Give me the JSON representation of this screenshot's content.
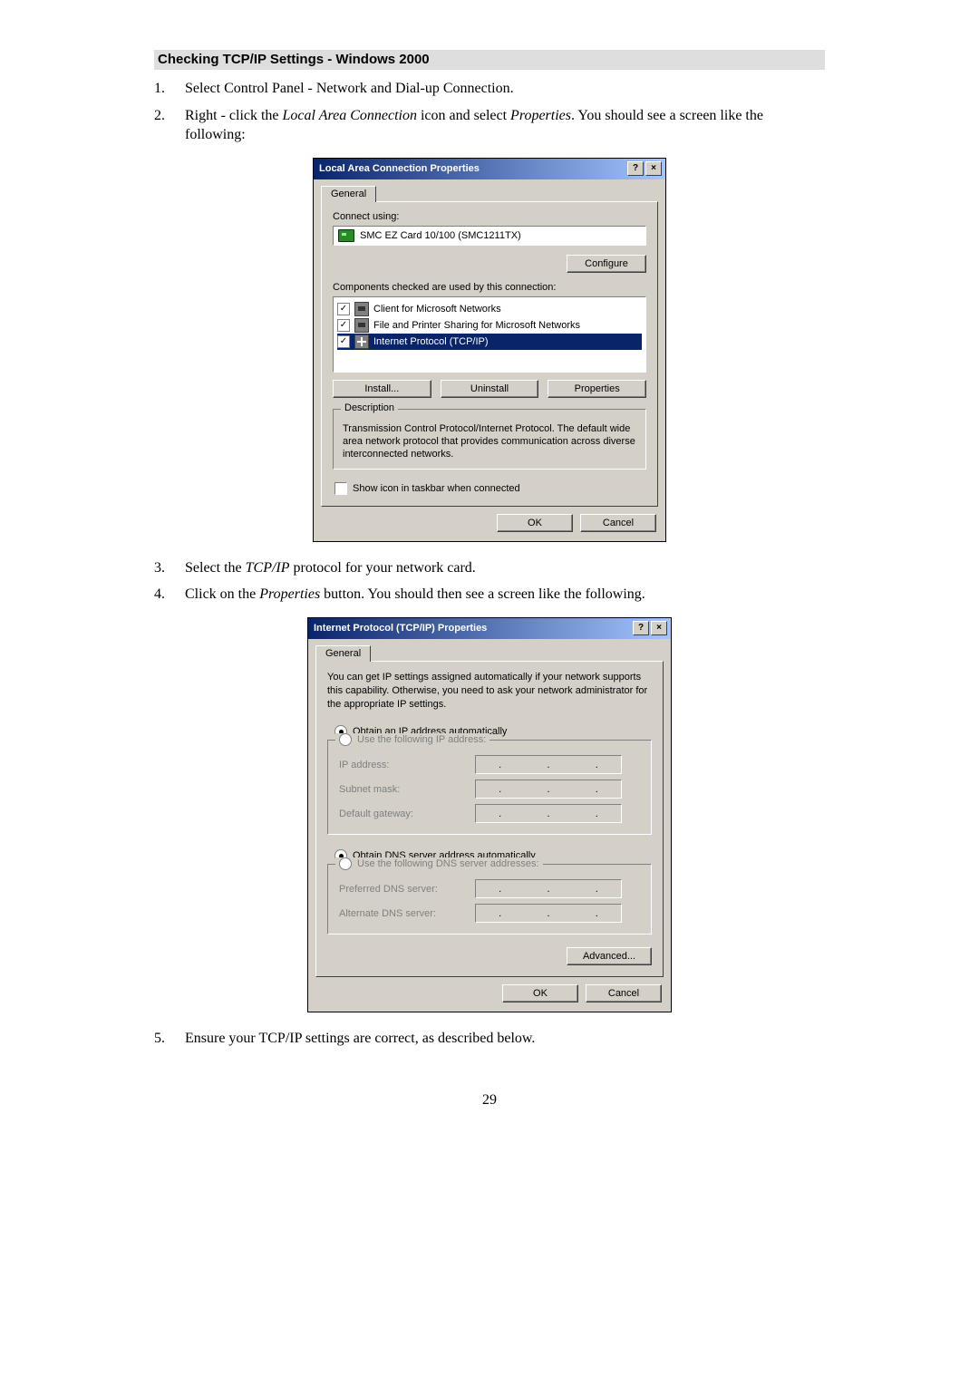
{
  "heading": "Checking TCP/IP Settings - Windows 2000",
  "steps_a": {
    "s1": {
      "n": "1.",
      "t": "Select Control Panel - Network and Dial-up Connection."
    },
    "s2": {
      "n": "2.",
      "pre": "Right - click the ",
      "it1": "Local Area Connection",
      "mid": " icon and select ",
      "it2": "Properties",
      "post": ". You should see a screen like the following:"
    }
  },
  "steps_b": {
    "s3": {
      "n": "3.",
      "pre": "Select the ",
      "it": "TCP/IP",
      "post": " protocol for your network card."
    },
    "s4": {
      "n": "4.",
      "pre": "Click on the ",
      "it": "Properties",
      "post": " button. You should then see a screen like the following."
    }
  },
  "steps_c": {
    "s5": {
      "n": "5.",
      "t": "Ensure your TCP/IP settings are correct, as described below."
    }
  },
  "dlg1": {
    "title": "Local Area Connection Properties",
    "help_q": "?",
    "close_x": "×",
    "tab_general": "General",
    "connect_using": "Connect using:",
    "adapter": "SMC EZ Card 10/100 (SMC1211TX)",
    "configure": "Configure",
    "components_label": "Components checked are used by this connection:",
    "comp1": "Client for Microsoft Networks",
    "comp2": "File and Printer Sharing for Microsoft Networks",
    "comp3": "Internet Protocol (TCP/IP)",
    "install": "Install...",
    "uninstall": "Uninstall",
    "properties": "Properties",
    "description_legend": "Description",
    "description_text": "Transmission Control Protocol/Internet Protocol. The default wide area network protocol that provides communication across diverse interconnected networks.",
    "show_icon": "Show icon in taskbar when connected",
    "ok": "OK",
    "cancel": "Cancel"
  },
  "dlg2": {
    "title": "Internet Protocol (TCP/IP) Properties",
    "help_q": "?",
    "close_x": "×",
    "tab_general": "General",
    "info": "You can get IP settings assigned automatically if your network supports this capability. Otherwise, you need to ask your network administrator for the appropriate IP settings.",
    "obtain_ip": "Obtain an IP address automatically",
    "use_ip_legend": "Use the following IP address:",
    "ip_address": "IP address:",
    "subnet": "Subnet mask:",
    "gateway": "Default gateway:",
    "obtain_dns": "Obtain DNS server address automatically",
    "use_dns_legend": "Use the following DNS server addresses:",
    "pref_dns": "Preferred DNS server:",
    "alt_dns": "Alternate DNS server:",
    "advanced": "Advanced...",
    "ok": "OK",
    "cancel": "Cancel"
  },
  "page_number": "29"
}
